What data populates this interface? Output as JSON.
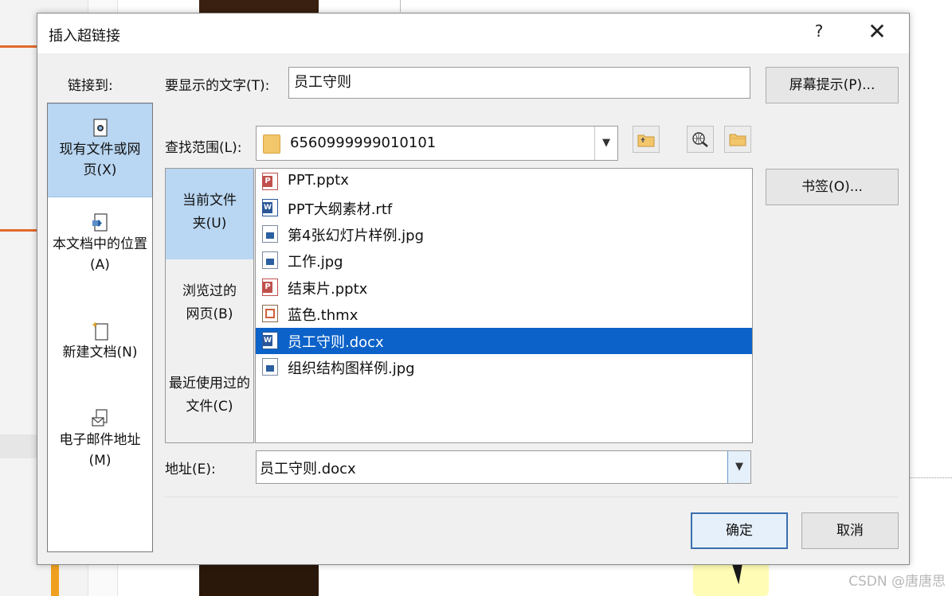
{
  "dialog": {
    "title": "插入超链接",
    "help": "?",
    "close": "✕"
  },
  "link_to": {
    "label": "链接到:",
    "items": [
      {
        "label": "现有文件或网页(X)",
        "icon": "existing-file-icon"
      },
      {
        "label": "本文档中的位置(A)",
        "icon": "place-in-document-icon"
      },
      {
        "label": "新建文档(N)",
        "icon": "new-document-icon"
      },
      {
        "label": "电子邮件地址(M)",
        "icon": "email-icon"
      }
    ]
  },
  "display_text": {
    "label": "要显示的文字(T):",
    "value": "员工守则"
  },
  "screentip_button": "屏幕提示(P)...",
  "look_in": {
    "label": "查找范围(L):",
    "value": "6560999999010101"
  },
  "places": [
    {
      "label": "当前文件夹(U)"
    },
    {
      "label": "浏览过的网页(B)"
    },
    {
      "label": "最近使用过的文件(C)"
    }
  ],
  "files": [
    {
      "name": "PPT.pptx",
      "type": "ppt"
    },
    {
      "name": "PPT大纲素材.rtf",
      "type": "word"
    },
    {
      "name": "第4张幻灯片样例.jpg",
      "type": "img"
    },
    {
      "name": "工作.jpg",
      "type": "img"
    },
    {
      "name": "结束片.pptx",
      "type": "ppt"
    },
    {
      "name": "蓝色.thmx",
      "type": "theme"
    },
    {
      "name": "员工守则.docx",
      "type": "word",
      "selected": true
    },
    {
      "name": "组织结构图样例.jpg",
      "type": "img"
    }
  ],
  "bookmark_button": "书签(O)...",
  "address": {
    "label": "地址(E):",
    "value": "员工守则.docx"
  },
  "ok_button": "确定",
  "cancel_button": "取消",
  "watermark": "CSDN @唐唐思",
  "colors": {
    "selection_blue": "#0c62c9",
    "nav_selected": "#b9d6f2",
    "dialog_bg": "#f0f0f0"
  }
}
